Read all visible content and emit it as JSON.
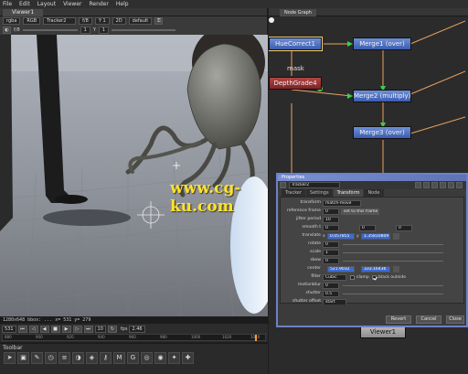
{
  "menu": [
    "File",
    "Edit",
    "Layout",
    "Viewer",
    "Render",
    "Help"
  ],
  "viewer": {
    "tab_label": "Viewer1",
    "toolbar1": {
      "channels": "rgba",
      "colorspace": "RGB",
      "layer": "Tracker2",
      "gain": "f/8",
      "gamma": "Y 1",
      "zoom_level": "2D",
      "lut": "default"
    },
    "toolbar2": {
      "fstop": "f/8",
      "frame_value": "1",
      "gamma_label": "Y",
      "gamma_value": "1"
    },
    "status": "1280x648 bbox: ... x= 531 y= 279",
    "playback": {
      "frame": "531",
      "step": "10",
      "fps_label": "fps",
      "fps": "2.46",
      "ticks": [
        "880",
        "900",
        "920",
        "940",
        "960",
        "980",
        "1000",
        "1020",
        "1040"
      ]
    },
    "watermark": "www.cg-ku.com"
  },
  "toolbar_panel": {
    "title": "Toolbar"
  },
  "node_graph": {
    "tab_label": "Node Graph",
    "nodes": {
      "hue_correct": "HueCorrect1",
      "depth_grade": "DepthGrade4",
      "merge1": "Merge1 (over)",
      "merge2": "Merge2 (multiply)",
      "merge3": "Merge3 (over)",
      "viewer1": "Viewer1"
    },
    "mask_label": "mask"
  },
  "properties": {
    "title": "Properties",
    "node_name": "Tracker2",
    "tabs": [
      "Tracker",
      "Settings",
      "Transform",
      "Node"
    ],
    "active_tab": "Transform",
    "fields": {
      "transform_label": "transform",
      "transform_value": "match-move",
      "reference_frame_label": "reference frame",
      "reference_frame_value": "0",
      "set_to_frame": "set to this frame",
      "jitter_period_label": "jitter period",
      "jitter_period_value": "10",
      "smooth_t_label": "smooth t",
      "smooth_t_value": "0",
      "smooth_r_value": "0",
      "smooth_s_value": "0",
      "translate_label": "translate",
      "translate_x_label": "x",
      "translate_x": "0.057855",
      "translate_y_label": "y",
      "translate_y": "1.35810809",
      "rotate_label": "rotate",
      "rotate_value": "0",
      "scale_label": "scale",
      "scale_value": "1",
      "skew_label": "skew",
      "skew_value": "0",
      "center_label": "center",
      "center_x": "521.9032",
      "center_y": "333.16436",
      "filter_label": "filter",
      "filter_value": "Cubic",
      "clamp_label": "clamp",
      "black_outside_label": "black outside",
      "motionblur_label": "motionblur",
      "motionblur_value": "0",
      "shutter_label": "shutter",
      "shutter_value": "0.5",
      "shutter_offset_label": "shutter offset",
      "shutter_offset_value": "start"
    },
    "checkboxes": {
      "clamp": false,
      "black_outside": true
    },
    "buttons": {
      "revert": "Revert",
      "cancel": "Cancel",
      "close": "Close"
    }
  },
  "colors": {
    "panel_bg": "#2b2b2b",
    "node_blue": "#4f6fc4",
    "node_red": "#9a3232",
    "link_orange": "#e8a060",
    "arrow_green": "#39d14a",
    "properties_title": "#7c91d4",
    "watermark_yellow": "#ffe22a"
  }
}
